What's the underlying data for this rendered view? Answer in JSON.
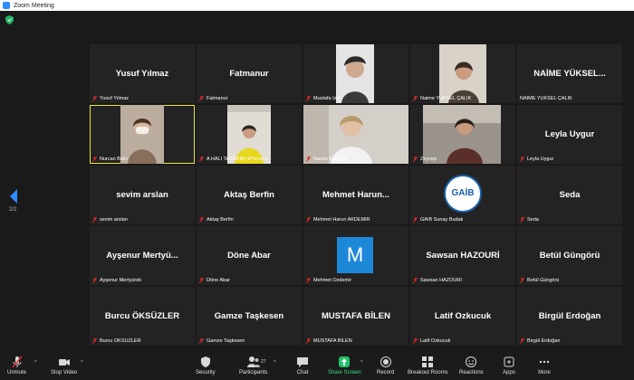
{
  "window": {
    "title": "Zoom Meeting"
  },
  "page_indicator": "2/2",
  "participants": [
    {
      "tile_name": "Yusuf Yılmaz",
      "label": "Yusuf Yılmaz"
    },
    {
      "tile_name": "Fatmanur",
      "label": "Fatmanur"
    },
    {
      "tile_name": "",
      "label": "Mustafa İzgi"
    },
    {
      "tile_name": "",
      "label": "Naime YÜKSEL ÇALIK"
    },
    {
      "tile_name": "NAİME YÜKSEL...",
      "label": "NAİME YÜKSEL ÇALIK"
    },
    {
      "tile_name": "",
      "label": "Nurcan Balcı"
    },
    {
      "tile_name": "",
      "label": "A HALI TASARIM (iPhone u"
    },
    {
      "tile_name": "",
      "label": "Nazan Kalebek"
    },
    {
      "tile_name": "",
      "label": "Zeynep"
    },
    {
      "tile_name": "Leyla Uygur",
      "label": "Leyla Uygur"
    },
    {
      "tile_name": "sevim arslan",
      "label": "sevim arslan"
    },
    {
      "tile_name": "Aktaş Berfin",
      "label": "Aktaş Berfin"
    },
    {
      "tile_name": "Mehmet Harun...",
      "label": "Mehmet Harun AKDEMİR"
    },
    {
      "tile_name": "",
      "label": "GAİB Sunay Budak"
    },
    {
      "tile_name": "Seda",
      "label": "Seda"
    },
    {
      "tile_name": "Ayşenur Mertyü...",
      "label": "Ayşenur Mertyürek"
    },
    {
      "tile_name": "Döne Abar",
      "label": "Döne Abar"
    },
    {
      "tile_name": "",
      "label": "Mehmet Özdemir"
    },
    {
      "tile_name": "Sawsan HAZOURİ",
      "label": "Sawsan HAZOURİ"
    },
    {
      "tile_name": "Betül Güngörü",
      "label": "Betül Güngörü"
    },
    {
      "tile_name": "Burcu ÖKSÜZLER",
      "label": "Burcu ÖKSÜZLER"
    },
    {
      "tile_name": "Gamze Taşkesen",
      "label": "Gamze Taşkesen"
    },
    {
      "tile_name": "MUSTAFA BİLEN",
      "label": "MUSTAFA BİLEN"
    },
    {
      "tile_name": "Latif Ozkucuk",
      "label": "Latif Ozkucuk"
    },
    {
      "tile_name": "Birgül Erdoğan",
      "label": "Birgül Erdoğan"
    }
  ],
  "avatars": {
    "mehmet_ozdemir": "M",
    "gaib_logo": "GAİB"
  },
  "toolbar": {
    "unmute": "Unmute",
    "stop_video": "Stop Video",
    "security": "Security",
    "participants": "Participants",
    "participants_count": "27",
    "chat": "Chat",
    "share_screen": "Share Screen",
    "record": "Record",
    "breakout_rooms": "Breakout Rooms",
    "reactions": "Reactions",
    "apps": "Apps",
    "more": "More"
  },
  "colors": {
    "active_speaker": "#e8e83b",
    "share_green": "#3ddc84",
    "muted_red": "#e02828",
    "zoom_blue": "#2d8cff",
    "avatar_blue": "#1e88d8"
  }
}
